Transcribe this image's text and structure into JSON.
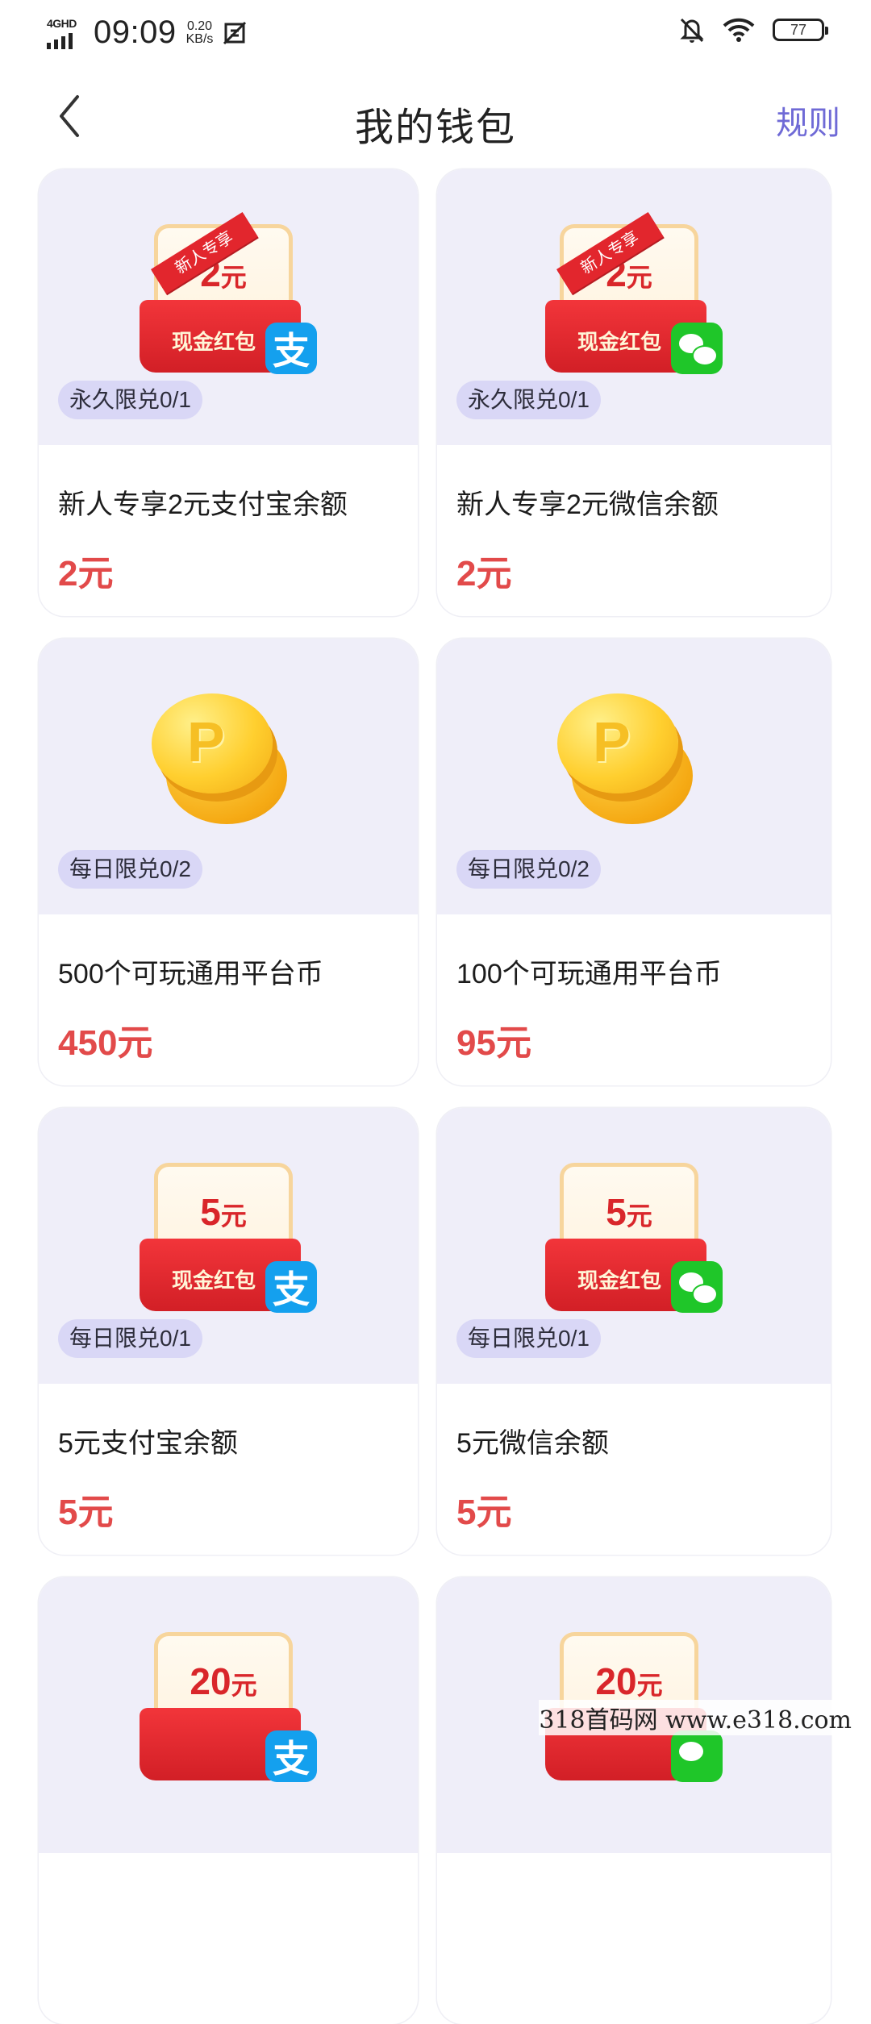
{
  "status_bar": {
    "network": "4GHD",
    "time": "09:09",
    "speed_value": "0.20",
    "speed_unit": "KB/s",
    "battery": "77"
  },
  "header": {
    "title": "我的钱包",
    "rules_label": "规则"
  },
  "cards": [
    {
      "badge": "永久限兑0/1",
      "title": "新人专享2元支付宝余额",
      "price": "2元",
      "ribbon": "新人专享",
      "amount": "2",
      "unit": "元",
      "packet_label": "现金红包",
      "logo_char": "支",
      "brand": "alipay"
    },
    {
      "badge": "永久限兑0/1",
      "title": "新人专享2元微信余额",
      "price": "2元",
      "ribbon": "新人专享",
      "amount": "2",
      "unit": "元",
      "packet_label": "现金红包",
      "brand": "wechat"
    },
    {
      "badge": "每日限兑0/2",
      "title": "500个可玩通用平台币",
      "price": "450元",
      "coin_letter": "P"
    },
    {
      "badge": "每日限兑0/2",
      "title": "100个可玩通用平台币",
      "price": "95元",
      "coin_letter": "P"
    },
    {
      "badge": "每日限兑0/1",
      "title": "5元支付宝余额",
      "price": "5元",
      "amount": "5",
      "unit": "元",
      "packet_label": "现金红包",
      "logo_char": "支",
      "brand": "alipay"
    },
    {
      "badge": "每日限兑0/1",
      "title": "5元微信余额",
      "price": "5元",
      "amount": "5",
      "unit": "元",
      "packet_label": "现金红包",
      "brand": "wechat"
    },
    {
      "amount": "20",
      "unit": "元",
      "logo_char": "支",
      "brand": "alipay"
    },
    {
      "amount": "20",
      "unit": "元",
      "brand": "wechat"
    }
  ],
  "colors": {
    "accent": "#6f6ad6",
    "price": "#e24a4a",
    "card_top_bg": "#efeef9",
    "badge_bg": "#d9d7f6",
    "alipay": "#14a0ee",
    "wechat": "#1fc629"
  },
  "icons": {
    "back": "chevron-left-icon",
    "mute": "bell-off-icon",
    "wifi": "wifi-icon",
    "battery": "battery-icon",
    "signal": "signal-icon",
    "screenshot": "screenshot-icon"
  },
  "watermark": "318首码网  www.e318.com"
}
